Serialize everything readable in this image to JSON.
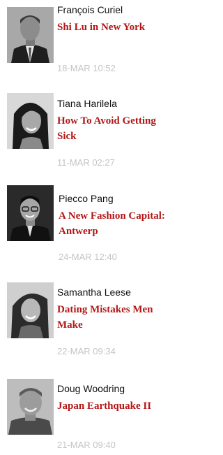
{
  "feed": {
    "items": [
      {
        "author": "François Curiel",
        "headline": "Shi Lu in New York",
        "timestamp": "18-MAR 10:52",
        "avatar_icon": "portrait-photo-icon"
      },
      {
        "author": "Tiana Harilela",
        "headline": "How To Avoid Getting Sick",
        "timestamp": "11-MAR 02:27",
        "avatar_icon": "portrait-photo-icon"
      },
      {
        "author": "Piecco Pang",
        "headline": "A New Fashion Capital: Antwerp",
        "timestamp": "24-MAR 12:40",
        "avatar_icon": "portrait-photo-icon"
      },
      {
        "author": "Samantha Leese",
        "headline": "Dating Mistakes Men Make",
        "timestamp": "22-MAR 09:34",
        "avatar_icon": "portrait-photo-icon"
      },
      {
        "author": "Doug Woodring",
        "headline": "Japan Earthquake II",
        "timestamp": "21-MAR 09:40",
        "avatar_icon": "portrait-photo-icon"
      }
    ]
  },
  "colors": {
    "headline": "#b31717",
    "author": "#111111",
    "timestamp": "#c4c4c4",
    "background": "#ffffff"
  }
}
